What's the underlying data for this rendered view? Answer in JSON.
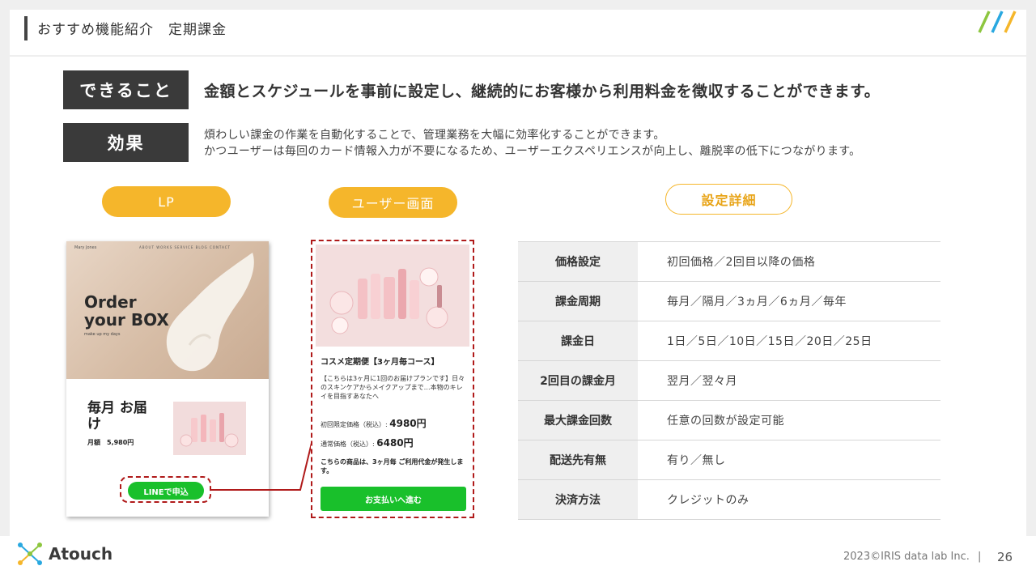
{
  "header": {
    "title": "おすすめ機能紹介　定期課金"
  },
  "summary": {
    "can_label": "できること",
    "can_text": "金額とスケジュールを事前に設定し、継続的にお客様から利用料金を徴収することができます。",
    "effect_label": "効果",
    "effect_line1": "煩わしい課金の作業を自動化することで、管理業務を大幅に効率化することができます。",
    "effect_line2": "かつユーザーは毎回のカード情報入力が不要になるため、ユーザーエクスペリエンスが向上し、離脱率の低下につながります。"
  },
  "pills": {
    "lp": "LP",
    "user": "ユーザー画面",
    "settings": "設定詳細"
  },
  "lp": {
    "brand": "Mary Jones",
    "nav": "ABOUT  WORKS  SERVICE  BLOG  CONTACT",
    "hero_title": "Order your BOX",
    "hero_sub": "make up my days",
    "monthly": "毎月 お届け",
    "price": "月額　5,980円",
    "line_button": "LINEで申込"
  },
  "user_screen": {
    "title": "コスメ定期便【3ヶ月毎コース】",
    "desc": "【こちらは3ヶ月に1回のお届けプランです】日々のスキンケアからメイクアップまで…本物のキレイを目指すあなたへ",
    "price1_label": "初回限定価格（税込）: ",
    "price1_value": "4980円",
    "price2_label": "通常価格（税込）: ",
    "price2_value": "6480円",
    "note": "こちらの商品は、3ヶ月毎 ご利用代金が発生します。",
    "pay_button": "お支払いへ進む"
  },
  "settings_table": [
    {
      "key": "価格設定",
      "value": "初回価格／2回目以降の価格"
    },
    {
      "key": "課金周期",
      "value": "毎月／隔月／3ヵ月／6ヵ月／毎年"
    },
    {
      "key": "課金日",
      "value": "1日／5日／10日／15日／20日／25日"
    },
    {
      "key": "2回目の課金月",
      "value": "翌月／翌々月"
    },
    {
      "key": "最大課金回数",
      "value": "任意の回数が設定可能"
    },
    {
      "key": "配送先有無",
      "value": "有り／無し"
    },
    {
      "key": "決済方法",
      "value": "クレジットのみ"
    }
  ],
  "footer": {
    "logo": "Atouch",
    "copyright": "2023©IRIS data lab Inc.",
    "separator": "|",
    "page_number": "26"
  },
  "colors": {
    "accent": "#f5b62b",
    "dark": "#3a3a3a",
    "line_green": "#19c02b",
    "connector_red": "#b01a1a"
  }
}
